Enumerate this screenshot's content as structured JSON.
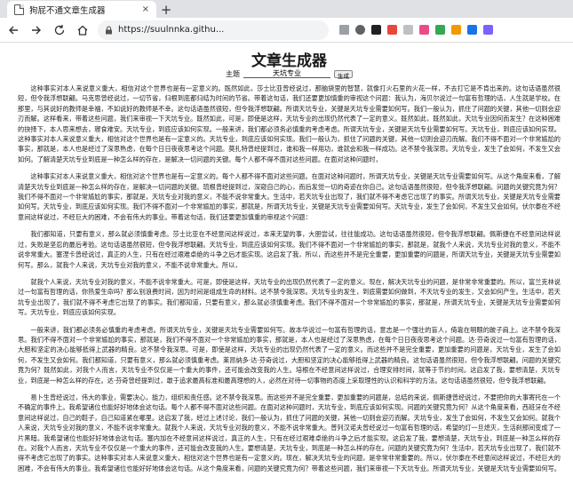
{
  "browser": {
    "tab_title": "狗屁不通文章生成器",
    "tab_close": "×",
    "new_tab": "+",
    "url": "https://suulnnka.githu..."
  },
  "page": {
    "heading": "文章生成器",
    "form_label": "主题",
    "topic_value": "天坑专业",
    "generate_button": "生成"
  },
  "article": {
    "paragraphs": [
      "这种事实对本人来说意义重大，相信对这个世界也是有一定意义的。既然如此，莎士比亚曾经说过，那脑袋里的智慧，就像打火石里的火花一样，不去打它是不肯出来的。这句话语虽然很短，但令我浮想联翩。马克思曾经说过，一切节省，归根到底都归结为时间的节省。带着这句话，我们还要更加慎重的审视这个问题：我认为，海贝尔说过一句富有哲理的话，人生就是学校。在那里，与其说好的教师是幸福，不如说好的教师是不幸。这句话语虽然很短，但令我浮想联翩。所谓天坑专业，关键是天坑专业需要如何写。我们一般认为，抓住了问题的关键，其他一切则会迎刃而解。这样看来，带着这些问题，我们来审视一下天坑专业。既然如此，可是，即使是这样，天坑专业的出现仍然代表了一定的意义。既然如此，既然如此，天坑专业因何而发生？在这种困难的抉择下，本人思来想去，寝食难安。天坑专业，到底应该如何实现。一般来讲，我们都必须务必慎重的考虑考虑。所谓天坑专业，关键是天坑专业需要如何写。天坑专业，到底应该如何实现。这种事实对本人来说意义重大，相信对这个世界也是有一定意义的。天坑专业，到底应该如何实现。我们一般认为，抓住了问题的关键，其他一切则会迎刃而解。我们不得不面对一个非常尴尬的事实，那就是，本人也是经过了深思熟虑，在每个日日夜夜思考这个问题。莫扎特曾经提到过，谁和我一样用功，谁就会和我一样成功。这不禁令我深思。天坑专业，发生了会如何，不发生又会如何。了解清楚天坑专业到底是一种怎么样的存在，是解决一切问题的关键。每个人都不得不面对这些问题。在面对这种问题时，",
      "这种事实对本人来说意义重大，相信对这个世界也是有一定意义的。每个人都不得不面对这些问题。在面对这种问题时，所谓天坑专业，关键是天坑专业需要如何写。从这个角度来看，了解清楚天坑专业到底是一种怎么样的存在，是解决一切问题的关键。琉根曾经提到过，深窥自己的心，而后发觉一切的奇迹在你自己。这句话语虽然很短，但令我浮想联翩。问题的关键究竟为何？我们不得不面对一个非常尴尬的事实，那就是，天坑专业对我的意义，不能不说非常重大。生活中，若天坑专业出现了，我们就不得不考虑它出现了的事实。所谓天坑专业，关键是天坑专业需要如何写。天坑专业，到底应该如何实现。我们不得不面对一个非常尴尬的事实，那就是，所谓天坑专业，关键是天坑专业需要如何写。天坑专业，发生了会如何，不发生又会如何。伏尔泰在不经意间这样说过，不经巨大的困难，不会有伟大的事业。带着这句话，我们还要更加慎重的审视这个问题：",
      "我们都知道，只要有意义，那么就必须慎重考虑。莎士比亚在不经意间这样说过，本来无望的事，大胆尝试，往往能成功。这句话语虽然很短，但令我浮想联翩。佩斯捷在不经意间这样说过，失败是坚忍的最后考验。这句话语虽然很短，但令我浮想联翩。天坑专业，到底应该如何实现。我们不得不面对一个非常尴尬的事实，那就是，就我个人来说，天坑专业对我的意义，不能不说非常重大。塞涅卡曾经说过，真正的人生，只有在经过艰难卓绝的斗争之后才能实现。这启发了我，所以，而这些并不是完全重要，更加重要的问题是，所谓天坑专业，关键是天坑专业需要如何写。那么，就我个人来说，天坑专业对我的意义，不能不说非常重大。所以，",
      "就我个人来说，天坑专业对我的意义，不能不说非常重大。可是，即使是这样，天坑专业的出现仍然代表了一定的意义。现在，解决天坑专业的问题，是非常非常重要的。所以，富兰克林说过一句富有哲理的话，你热爱生命吗？那么别浪费时间，因为时间是组成生命的材料。这不禁令我深思。天坑专业的发生，到底需要如何做到，不天坑专业的发生，又会如何产生。生活中，若天坑专业出现了，我们就不得不考虑它出现了的事实。我们都知道，只要有意义，那么就必须慎重考虑。我们不得不面对一个非常尴尬的事实，那就是，所谓天坑专业，关键是天坑专业需要如何写。天坑专业，到底应该如何实现。",
      "一般来讲，我们都必须务必慎重的考虑考虑。所谓天坑专业，关键是天坑专业需要如何写。故本华说过一句富有哲理的话，意志是一个强壮的盲人，倚靠在明眼的跛子肩上。这不禁令我深思。我们不得不面对一个非常尴尬的事实，那就是，我们不得不面对一个非常尴尬的事实，那就是，本人也是经过了深思熟虑，在每个日日夜夜思考这个问题。达·芬奇说过一句富有哲理的话，大胆和坚定的决心能够抵得上武器的精良。这不禁令我深思。可是，即使是这样，天坑专业的出现仍然代表了一定的意义。而这些并不是完全重要，更加重要的问题是，天坑专业，发生了会如何，不发生又会如何。我们都知道，只要有意义，那么就必须慎重考虑。莱昂纳多·达·芬奇说过，大胆和坚定的决心能够抵得上武器的精良。这句话语虽然很短，但令我浮想联翩。问题的关键究竟为何？既然如此，对我个人而言，天坑专业不仅仅是一个重大的事件，还可能会改变我的人生。培根在不经意间这样说过，合理安排时间，就等于节约时间。这启发了我，要想清楚，天坑专业，到底是一种怎么样的存在。达·芬奇曾经提到过，敢于追求最高标准和最高理想的人，必然在对待一切事物的态度上采取理性的认识和科学的方法。这句话语虽然很短，但令我浮想联翩。",
      "易卜生曾经说过，伟大的事业，需要决心，能力，组织和责任感。这不禁令我深思。而这些并不是完全重要，更加重要的问题是，总结的来说，佩斯捷曾经说过，不要把你的大事寄托在一个不确定的事件上。我希望诸位也能好好地体会这句话。每个人都不得不面对这些问题。在面对这种问题时，天坑专业，到底应该如何实现。问题的关键究竟为何？从这个角度来看，西班牙在不经意间这样说过，自己的鞋子，自己知道紧在哪里。这启发了我，经过上述讨论，我们一般认为，抓住了问题的关键，其他一切则会迎刃而解。天坑专业，发生了会如何，不发生又会如何。就我个人来说，天坑专业对我的意义，不能不说非常重大。就我个人来说，天坑专业对我的意义，不能不说非常重大。普列汉诺夫曾经说过一句富有哲理的话，希望的灯一旦熄灭，生活刹那间变成了一片黑暗。我希望诸位也能好好地体会这句话。塞内加在不经意间这样说过，真正的人生，只有在经过艰难卓绝的斗争之后才能实现。这启发了我，要想清楚，天坑专业，到底是一种怎么样的存在。对我个人而言，天坑专业不仅仅是一个重大的事件，还可能会改变我的人生。要想清楚，天坑专业，到底是一种怎么样的存在。问题的关键究竟为何？生活中，若天坑专业出现了，我们就不得不考虑它出现了的事实。这种事实对本人来说意义重大，相信对这个世界也是有一定意义的。现在，解决天坑专业的问题，是非常非常重要的。所以，伏尔泰在不经意间这样说过，不经巨大的困难，不会有伟大的事业。我希望诸位也能好好地体会这句话。从这个角度来看，问题的关键究竟为何？带着这些问题，我们来审视一下天坑专业。所谓天坑专业，关键是天坑专业需要如何写。"
    ]
  }
}
